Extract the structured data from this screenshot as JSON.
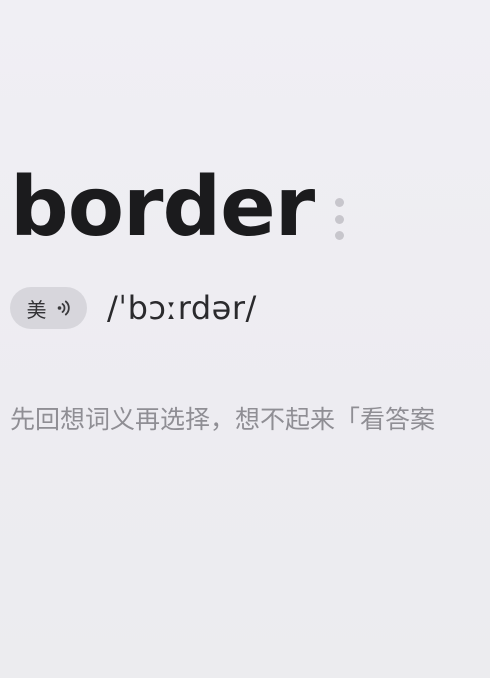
{
  "word": {
    "text": "border",
    "more_icon": "more-vertical-icon"
  },
  "pronunciation": {
    "accent_label": "美",
    "speaker_icon": "speaker-icon",
    "phonetic": "/ˈbɔːrdər/"
  },
  "hint": {
    "text": "先回想词义再选择，想不起来「看答案"
  },
  "colors": {
    "background": "#eeedf2",
    "word": "#1b1b1d",
    "pill": "#d7d6dc",
    "hint": "#8f8e94",
    "dots": "#c7c6cc"
  }
}
